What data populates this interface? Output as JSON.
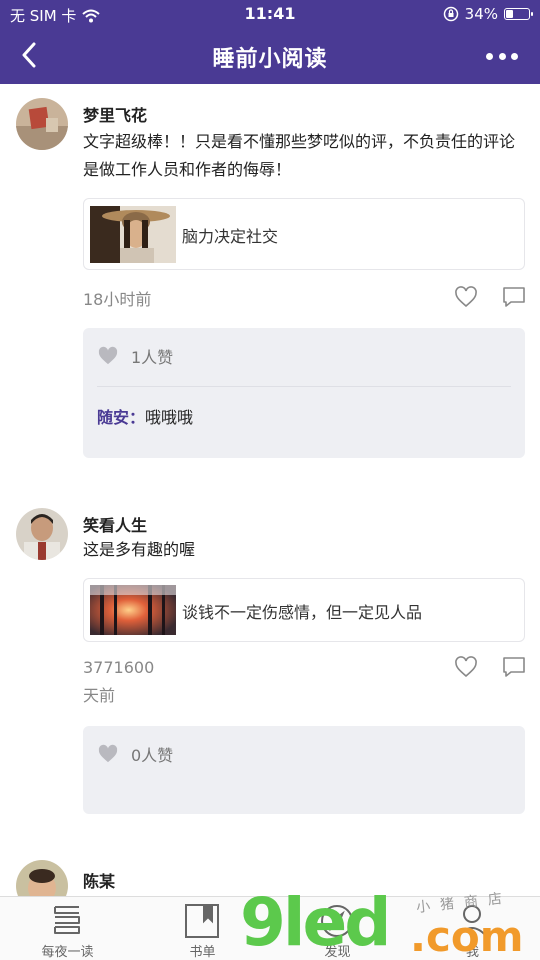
{
  "status": {
    "carrier": "无 SIM 卡",
    "time": "11:41",
    "battery": "34%",
    "battery_level": 0.34
  },
  "nav": {
    "title": "睡前小阅读"
  },
  "comments": [
    {
      "user": "梦里飞花",
      "text": "文字超级棒！！只是看不懂那些梦呓似的评，不负责任的评论是做工作人员和作者的侮辱！",
      "link_title": "脑力决定社交",
      "time": "18小时前",
      "likes": "1人赞",
      "reply_user": "随安：",
      "reply_text": "哦哦哦"
    },
    {
      "user": "笑看人生",
      "text": "这是多有趣的喔",
      "link_title": "谈钱不一定伤感情，但一定见人品",
      "time_line1": "3771600",
      "time_line2": "天前",
      "likes": "0人赞"
    },
    {
      "user": "陈某"
    }
  ],
  "tabs": [
    {
      "label": "每夜一读",
      "icon": "reading-icon"
    },
    {
      "label": "书单",
      "icon": "bookmark-book-icon"
    },
    {
      "label": "发现",
      "icon": "compass-icon"
    },
    {
      "label": "我",
      "icon": "person-icon"
    }
  ],
  "watermark": {
    "brand": "9led",
    "suffix": ".com",
    "tagline": "小猪商店"
  },
  "colors": {
    "brand": "#4a3a94",
    "panel": "#eeeff3",
    "meta": "#888888"
  }
}
